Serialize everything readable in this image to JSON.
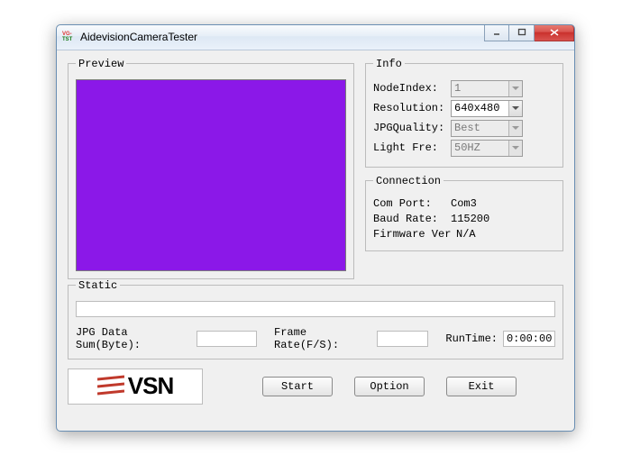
{
  "window": {
    "title": "AidevisionCameraTester"
  },
  "groups": {
    "preview": "Preview",
    "info": "Info",
    "connection": "Connection",
    "static": "Static"
  },
  "info": {
    "node_index_label": "NodeIndex:",
    "node_index_value": "1",
    "resolution_label": "Resolution:",
    "resolution_value": "640x480",
    "jpg_quality_label": "JPGQuality:",
    "jpg_quality_value": "Best",
    "light_fre_label": "Light Fre:",
    "light_fre_value": "50HZ"
  },
  "connection": {
    "com_port_label": "Com Port:",
    "com_port_value": "Com3",
    "baud_rate_label": "Baud Rate:",
    "baud_rate_value": "115200",
    "firmware_label": "Firmware Ver",
    "firmware_value": "N/A"
  },
  "static": {
    "jpg_sum_label": "JPG Data Sum(Byte):",
    "jpg_sum_value": "",
    "frame_rate_label": "Frame Rate(F/S):",
    "frame_rate_value": "",
    "runtime_label": "RunTime:",
    "runtime_value": "0:00:00"
  },
  "buttons": {
    "start": "Start",
    "option": "Option",
    "exit": "Exit"
  },
  "logo_text": "VSN",
  "colors": {
    "preview_fill": "#8b18e8"
  }
}
